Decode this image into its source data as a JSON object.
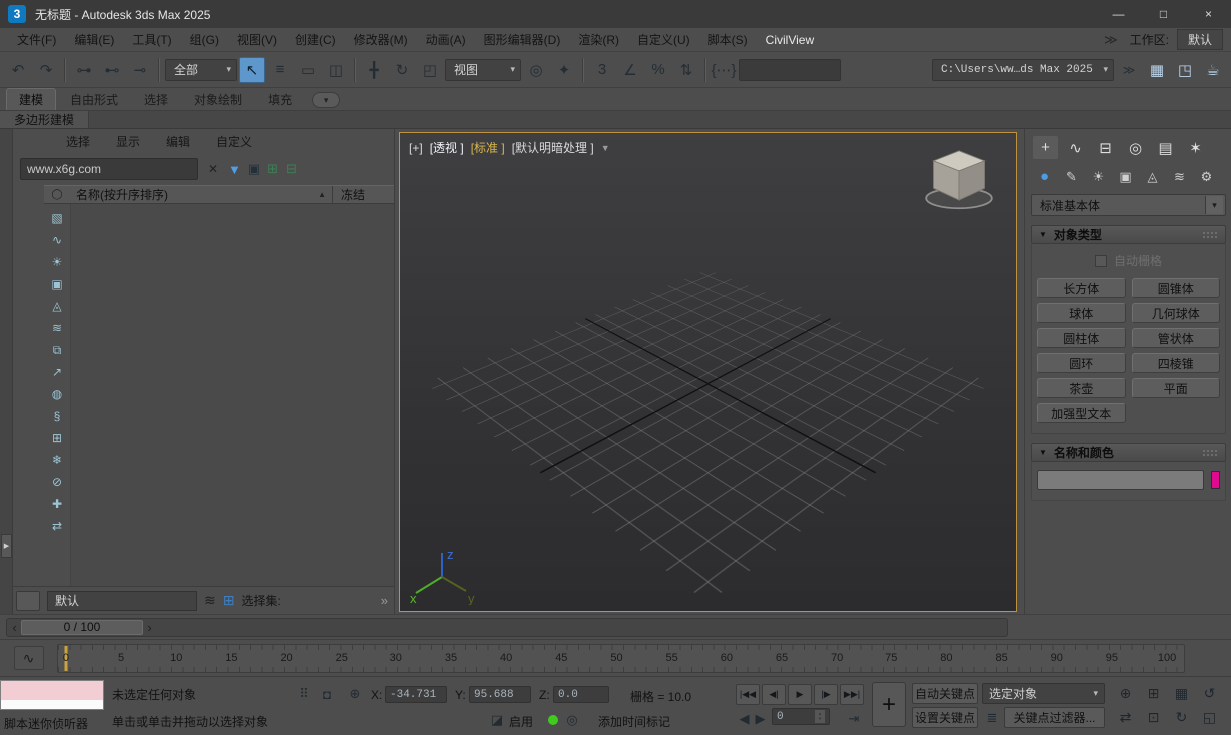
{
  "ui": {
    "caret": "▾",
    "spin_up": "▴",
    "spin_down": "▾"
  },
  "titlebar": {
    "app_badge": "3",
    "title": "无标题 - Autodesk 3ds Max 2025",
    "minimize_glyph": "—",
    "maximize_glyph": "□",
    "close_glyph": "×"
  },
  "menubar": {
    "items": [
      {
        "key": "file",
        "label": "文件(F)",
        "cls": ""
      },
      {
        "key": "edit",
        "label": "编辑(E)",
        "cls": ""
      },
      {
        "key": "tools",
        "label": "工具(T)",
        "cls": ""
      },
      {
        "key": "group",
        "label": "组(G)",
        "cls": ""
      },
      {
        "key": "views",
        "label": "视图(V)",
        "cls": ""
      },
      {
        "key": "create",
        "label": "创建(C)",
        "cls": ""
      },
      {
        "key": "modifiers",
        "label": "修改器(M)",
        "cls": ""
      },
      {
        "key": "animation",
        "label": "动画(A)",
        "cls": ""
      },
      {
        "key": "graph-editors",
        "label": "图形编辑器(D)",
        "cls": ""
      },
      {
        "key": "rendering",
        "label": "渲染(R)",
        "cls": ""
      },
      {
        "key": "customize",
        "label": "自定义(U)",
        "cls": ""
      },
      {
        "key": "scripting",
        "label": "脚本(S)",
        "cls": ""
      },
      {
        "key": "civilview",
        "label": "CivilView",
        "cls": "light"
      }
    ],
    "overflow_glyph": "≫",
    "workspace_label": "工作区:",
    "workspace_value": "默认"
  },
  "toolbar": {
    "group_history": [
      {
        "name": "undo-icon",
        "glyph": "↶",
        "cls": ""
      },
      {
        "name": "redo-icon",
        "glyph": "↷",
        "cls": ""
      }
    ],
    "group_link": [
      {
        "name": "select-and-link-icon",
        "glyph": "⊶",
        "cls": ""
      },
      {
        "name": "unlink-selection-icon",
        "glyph": "⊷",
        "cls": ""
      },
      {
        "name": "bind-to-space-warp-icon",
        "glyph": "⊸",
        "cls": ""
      }
    ],
    "selection_filter_value": "全部",
    "group_select": [
      {
        "name": "select-object-icon",
        "glyph": "↖",
        "cls": "active"
      },
      {
        "name": "select-by-name-icon",
        "glyph": "≡",
        "cls": ""
      },
      {
        "name": "rectangular-selection-region-icon",
        "glyph": "▭",
        "cls": ""
      },
      {
        "name": "window-crossing-toggle-icon",
        "glyph": "◫",
        "cls": ""
      }
    ],
    "group_transform": [
      {
        "name": "select-and-move-icon",
        "glyph": "╋",
        "cls": ""
      },
      {
        "name": "select-and-rotate-icon",
        "glyph": "↻",
        "cls": ""
      },
      {
        "name": "select-and-scale-icon",
        "glyph": "◰",
        "cls": ""
      }
    ],
    "ref_coord_value": "视图",
    "group_pivot": [
      {
        "name": "use-pivot-point-center-icon",
        "glyph": "◎",
        "cls": ""
      },
      {
        "name": "select-and-manipulate-icon",
        "glyph": "✦",
        "cls": ""
      }
    ],
    "group_snap": [
      {
        "name": "snap-toggle-3d-icon",
        "glyph": "3",
        "cls": ""
      },
      {
        "name": "angle-snap-icon",
        "glyph": "∠",
        "cls": ""
      },
      {
        "name": "percent-snap-icon",
        "glyph": "%",
        "cls": ""
      },
      {
        "name": "spinner-snap-icon",
        "glyph": "⇅",
        "cls": ""
      }
    ],
    "group_sets": [
      {
        "name": "edit-named-selection-sets-icon",
        "glyph": "{⋯}",
        "cls": ""
      }
    ],
    "path_value": "C:\\Users\\ww…ds Max 2025",
    "overflow_glyph": "≫",
    "group_render": [
      {
        "name": "render-setup-icon",
        "glyph": "▦",
        "cls": "render-icon"
      },
      {
        "name": "rendered-frame-window-icon",
        "glyph": "◳",
        "cls": "render-icon"
      },
      {
        "name": "render-production-icon",
        "glyph": "☕",
        "cls": "render-icon"
      }
    ]
  },
  "ribbon": {
    "tabs": [
      {
        "key": "modeling",
        "label": "建模",
        "cls": "active"
      },
      {
        "key": "freeform",
        "label": "自由形式",
        "cls": ""
      },
      {
        "key": "selection",
        "label": "选择",
        "cls": ""
      },
      {
        "key": "object-paint",
        "label": "对象绘制",
        "cls": ""
      },
      {
        "key": "populate",
        "label": "填充",
        "cls": ""
      }
    ],
    "config_glyph": "▾",
    "subtab": "多边形建模"
  },
  "left_edge": {
    "expand_glyph": "▶"
  },
  "scene_explorer": {
    "menus": [
      {
        "key": "select",
        "label": "选择"
      },
      {
        "key": "display",
        "label": "显示"
      },
      {
        "key": "edit",
        "label": "编辑"
      },
      {
        "key": "customize",
        "label": "自定义"
      }
    ],
    "search_value": "www.x6g.com",
    "clear_glyph": "✕",
    "filter_glyph": "▼",
    "lock_glyph": "▣",
    "tools": [
      {
        "name": "pick-parent-icon",
        "glyph": "⊞"
      },
      {
        "name": "pick-children-icon",
        "glyph": "⊟"
      }
    ],
    "header_icon_glyph": "◯",
    "header_name": "名称(按升序排序)",
    "sort_glyph": "▲",
    "header_frozen": "冻结",
    "strip": [
      {
        "name": "se-display-geometry-icon",
        "glyph": "▧"
      },
      {
        "name": "se-display-shapes-icon",
        "glyph": "∿"
      },
      {
        "name": "se-display-lights-icon",
        "glyph": "☀"
      },
      {
        "name": "se-display-cameras-icon",
        "glyph": "▣"
      },
      {
        "name": "se-display-helpers-icon",
        "glyph": "◬"
      },
      {
        "name": "se-display-spacewarps-icon",
        "glyph": "≋"
      },
      {
        "name": "se-display-groups-icon",
        "glyph": "⧉"
      },
      {
        "name": "se-display-xrefs-icon",
        "glyph": "↗"
      },
      {
        "name": "se-display-materials-icon",
        "glyph": "◍"
      },
      {
        "name": "se-display-bones-icon",
        "glyph": "§"
      },
      {
        "name": "se-display-containers-icon",
        "glyph": "⊞"
      },
      {
        "name": "se-display-frozen-icon",
        "glyph": "❄"
      },
      {
        "name": "se-display-hidden-icon",
        "glyph": "⊘"
      },
      {
        "name": "se-pin-explorer-icon",
        "glyph": "✚"
      },
      {
        "name": "se-sync-selection-icon",
        "glyph": "⇄"
      }
    ],
    "footer": {
      "layer_value": "默认",
      "layers_icon_glyph": "≋",
      "grid_icon_glyph": "⊞",
      "selection_set_label": "选择集:",
      "overflow_glyph": "»"
    }
  },
  "viewport": {
    "labels": {
      "plus": "[+]",
      "pov": "[透视 ]",
      "standard": "[标准 ]",
      "shading": "[默认明暗处理 ]",
      "filter_glyph": "▼"
    },
    "axis": {
      "x": "x",
      "y": "y",
      "z": "z"
    }
  },
  "command_panel": {
    "tabs": [
      {
        "name": "tab-create-icon",
        "glyph": "+",
        "cls": "active"
      },
      {
        "name": "tab-modify-icon",
        "glyph": "∿",
        "cls": ""
      },
      {
        "name": "tab-hierarchy-icon",
        "glyph": "⊟",
        "cls": ""
      },
      {
        "name": "tab-motion-icon",
        "glyph": "◎",
        "cls": ""
      },
      {
        "name": "tab-display-icon",
        "glyph": "▤",
        "cls": ""
      },
      {
        "name": "tab-utilities-icon",
        "glyph": "✶",
        "cls": ""
      }
    ],
    "subtabs": [
      {
        "name": "create-geometry-icon",
        "glyph": "●",
        "cls": "active"
      },
      {
        "name": "create-shapes-icon",
        "glyph": "✎",
        "cls": ""
      },
      {
        "name": "create-lights-icon",
        "glyph": "☀",
        "cls": ""
      },
      {
        "name": "create-cameras-icon",
        "glyph": "▣",
        "cls": ""
      },
      {
        "name": "create-helpers-icon",
        "glyph": "◬",
        "cls": ""
      },
      {
        "name": "create-spacewarps-icon",
        "glyph": "≋",
        "cls": ""
      },
      {
        "name": "create-systems-icon",
        "glyph": "⚙",
        "cls": ""
      }
    ],
    "category_value": "标准基本体",
    "rollouts": {
      "object_type": {
        "title": "对象类型",
        "arrow": "▼",
        "autogrid_label": "自动栅格",
        "buttons": [
          {
            "key": "box",
            "label": "长方体"
          },
          {
            "key": "cone",
            "label": "圆锥体"
          },
          {
            "key": "sphere",
            "label": "球体"
          },
          {
            "key": "geosphere",
            "label": "几何球体"
          },
          {
            "key": "cylinder",
            "label": "圆柱体"
          },
          {
            "key": "tube",
            "label": "管状体"
          },
          {
            "key": "torus",
            "label": "圆环"
          },
          {
            "key": "pyramid",
            "label": "四棱锥"
          },
          {
            "key": "teapot",
            "label": "茶壶"
          },
          {
            "key": "plane",
            "label": "平面"
          },
          {
            "key": "textplus",
            "label": "加强型文本"
          }
        ]
      },
      "name_color": {
        "title": "名称和颜色",
        "arrow": "▼",
        "name_value": "",
        "swatch_color": "#e00a8e"
      }
    }
  },
  "time": {
    "prev_glyph": "‹",
    "slider_value": "0 / 100",
    "next_glyph": "›",
    "curve_editor_glyph": "∿",
    "ticks": [
      {
        "label": "0",
        "x": "0.7%"
      },
      {
        "label": "5",
        "x": "5.6%"
      },
      {
        "label": "10",
        "x": "10.5%"
      },
      {
        "label": "15",
        "x": "15.4%"
      },
      {
        "label": "20",
        "x": "20.3%"
      },
      {
        "label": "25",
        "x": "25.2%"
      },
      {
        "label": "30",
        "x": "30.0%"
      },
      {
        "label": "35",
        "x": "34.9%"
      },
      {
        "label": "40",
        "x": "39.8%"
      },
      {
        "label": "45",
        "x": "44.7%"
      },
      {
        "label": "50",
        "x": "49.6%"
      },
      {
        "label": "55",
        "x": "54.5%"
      },
      {
        "label": "60",
        "x": "59.4%"
      },
      {
        "label": "65",
        "x": "64.3%"
      },
      {
        "label": "70",
        "x": "69.2%"
      },
      {
        "label": "75",
        "x": "74.0%"
      },
      {
        "label": "80",
        "x": "78.9%"
      },
      {
        "label": "85",
        "x": "83.8%"
      },
      {
        "label": "90",
        "x": "88.7%"
      },
      {
        "label": "95",
        "x": "93.6%"
      },
      {
        "label": "100",
        "x": "98.5%"
      }
    ]
  },
  "status": {
    "listener_label": "脚本迷你侦听器",
    "status_line": "未选定任何对象",
    "prompt_line": "单击或单击并拖动以选择对象",
    "isolate_glyph": "⠿",
    "lock_glyph": "◘",
    "xform_glyph": "⊕",
    "x_label": "X:",
    "x_value": "-34.731",
    "y_label": "Y:",
    "y_value": "95.688",
    "z_label": "Z:",
    "z_value": "0.0",
    "grid_text": "栅格 = 10.0",
    "playback": [
      {
        "name": "go-to-start-button",
        "glyph": "|◀◀"
      },
      {
        "name": "previous-frame-button",
        "glyph": "◀|"
      },
      {
        "name": "play-button",
        "glyph": "▶"
      },
      {
        "name": "next-frame-button",
        "glyph": "|▶"
      },
      {
        "name": "go-to-end-button",
        "glyph": "▶▶|"
      }
    ],
    "big_key_glyph": "+",
    "auto_key_label": "自动关键点",
    "set_key_label": "设置关键点",
    "key_target_value": "选定对象",
    "keyboard_override_glyph": "≣",
    "key_filters_label": "关键点过滤器...",
    "degradation_glyph": "◪",
    "enable_label": "启用",
    "status_dot_color": "#3ecb1e",
    "zero_badge_glyph": "◎",
    "time_tag_label": "添加时间标记",
    "prev_key_glyph": "◀",
    "next_key_glyph": "▶",
    "frame_value": "0",
    "key_mode_glyph": "⇥",
    "nav_row1": [
      {
        "name": "zoom-icon",
        "glyph": "⊕"
      },
      {
        "name": "zoom-all-views-icon",
        "glyph": "⊞"
      },
      {
        "name": "zoom-extents-all-icon",
        "glyph": "▦"
      },
      {
        "name": "orbit-icon",
        "glyph": "↺"
      }
    ],
    "nav_row2": [
      {
        "name": "pan-view-icon",
        "glyph": "⇄"
      },
      {
        "name": "zoom-region-icon",
        "glyph": "⊡"
      },
      {
        "name": "orbit-subobject-icon",
        "glyph": "↻"
      },
      {
        "name": "maximize-viewport-toggle-icon",
        "glyph": "◱"
      }
    ]
  }
}
